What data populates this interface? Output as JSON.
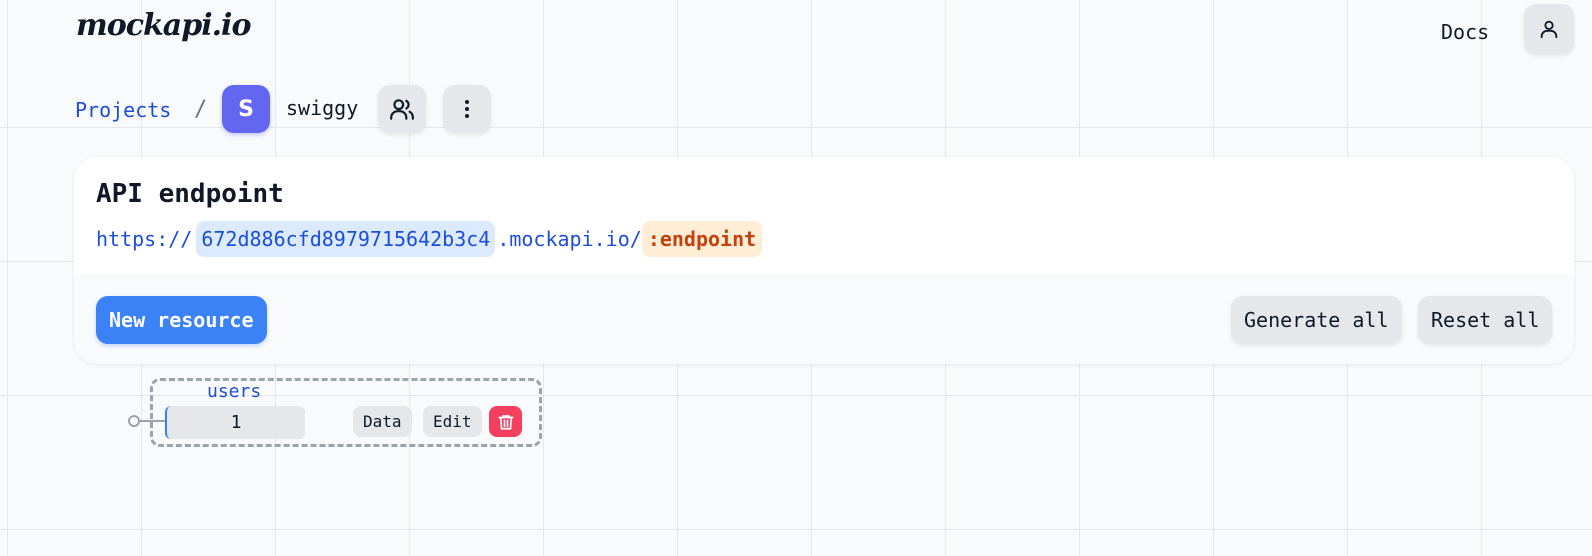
{
  "header": {
    "logo": "mockapi.io",
    "docs_label": "Docs",
    "user_icon": "user-icon"
  },
  "breadcrumb": {
    "projects_label": "Projects",
    "separator": "/",
    "avatar_letter": "S",
    "project_name": "swiggy",
    "members_icon": "users-icon",
    "more_icon": "more-vertical-icon"
  },
  "endpoint_card": {
    "title": "API endpoint",
    "url_scheme": "https://",
    "url_id": "672d886cfd8979715642b3c4",
    "url_domain": ".mockapi.io/",
    "url_endpoint": ":endpoint",
    "new_resource_label": "New resource",
    "generate_all_label": "Generate all",
    "reset_all_label": "Reset all"
  },
  "resources": [
    {
      "name": "users",
      "count": "1",
      "data_label": "Data",
      "edit_label": "Edit",
      "delete_icon": "trash-icon"
    }
  ],
  "colors": {
    "accent": "#3b82f6",
    "avatar": "#6366f1",
    "link": "#1d4ed8",
    "endpoint": "#c2410c",
    "danger": "#f43f5e"
  }
}
